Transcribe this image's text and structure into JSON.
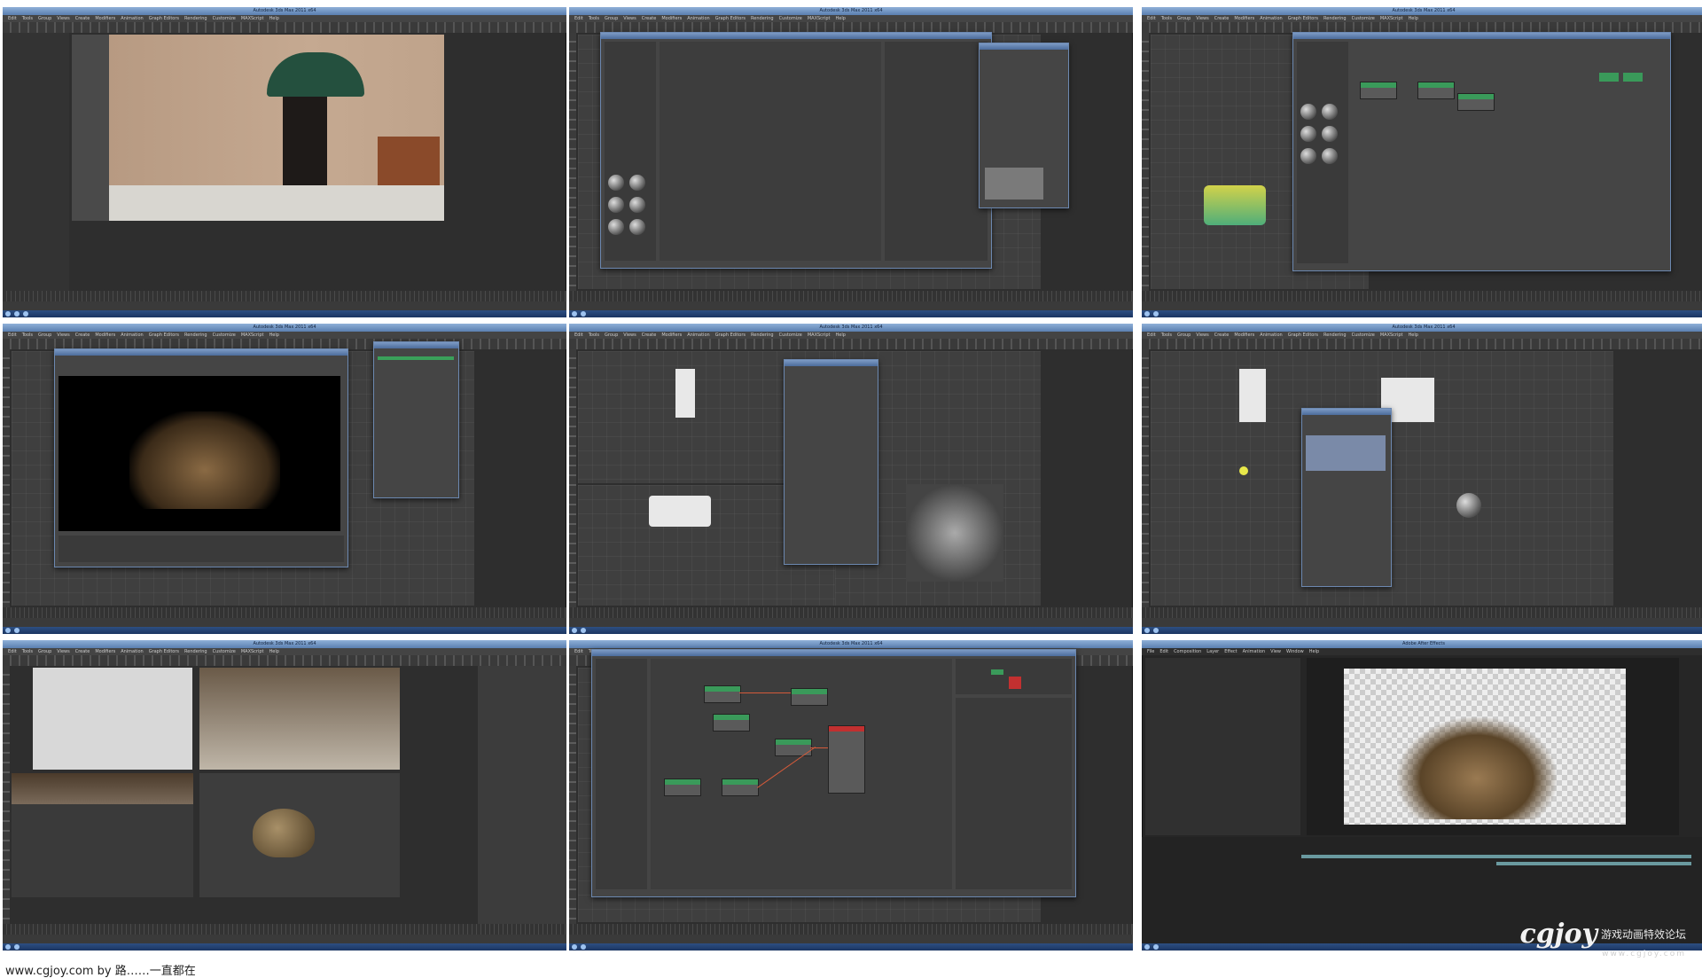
{
  "caption": "www.cgjoy.com by 路……一直都在",
  "watermark": {
    "logo": "cgjoy",
    "tagline": "游戏动画特效论坛",
    "url": "www.cgjoy.com"
  },
  "app": {
    "title": "Autodesk 3ds Max 2011 x64",
    "menu": [
      "Edit",
      "Tools",
      "Group",
      "Views",
      "Create",
      "Modifiers",
      "Animation",
      "Graph Editors",
      "Rendering",
      "Customize",
      "MAXScript",
      "Help"
    ]
  },
  "ae": {
    "title": "Adobe After Effects",
    "menu": [
      "File",
      "Edit",
      "Composition",
      "Layer",
      "Effect",
      "Animation",
      "View",
      "Window",
      "Help"
    ]
  },
  "panels": [
    {
      "id": "p1",
      "label": "Viewport - building photo with awning"
    },
    {
      "id": "p2",
      "label": "Slate Material Editor"
    },
    {
      "id": "p3",
      "label": "Slate Material Editor over wagon viewport"
    },
    {
      "id": "p4",
      "label": "Rendered Frame Window - wagon"
    },
    {
      "id": "p5",
      "label": "Quad viewports with dialog"
    },
    {
      "id": "p6",
      "label": "Quad viewports with dialog 2"
    },
    {
      "id": "p7",
      "label": "Quad viewports - debris"
    },
    {
      "id": "p8",
      "label": "Slate Material Editor node graph"
    },
    {
      "id": "p9",
      "label": "After Effects composition"
    }
  ],
  "colors": {
    "titlebar": "#5a7fb0",
    "ui_dark": "#2e2e2e",
    "node_green": "#3a9a5a",
    "node_red": "#c23030",
    "wire": "#d45a3a"
  }
}
